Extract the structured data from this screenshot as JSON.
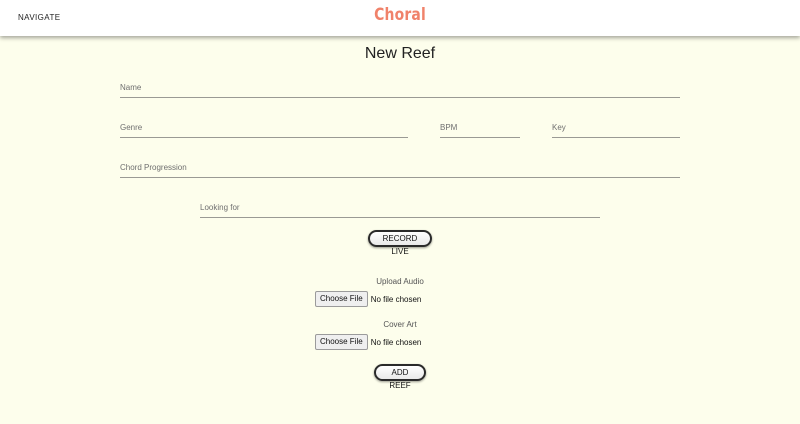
{
  "appbar": {
    "navigate_label": "NAVIGATE",
    "brand": "Choral"
  },
  "page": {
    "title": "New Reef"
  },
  "form": {
    "name_placeholder": "Name",
    "genre_placeholder": "Genre",
    "bpm_placeholder": "BPM",
    "key_placeholder": "Key",
    "chord_progression_placeholder": "Chord Progression",
    "looking_for_placeholder": "Looking for",
    "record_live_label": "RECORD LIVE",
    "upload_audio_label": "Upload Audio",
    "cover_art_label": "Cover Art",
    "choose_file_label": "Choose File",
    "no_file_text": "No file chosen",
    "add_reef_label": "ADD REEF"
  },
  "colors": {
    "background": "#fdfeec",
    "brand": "#f0826a",
    "appbar": "#ffffff"
  }
}
